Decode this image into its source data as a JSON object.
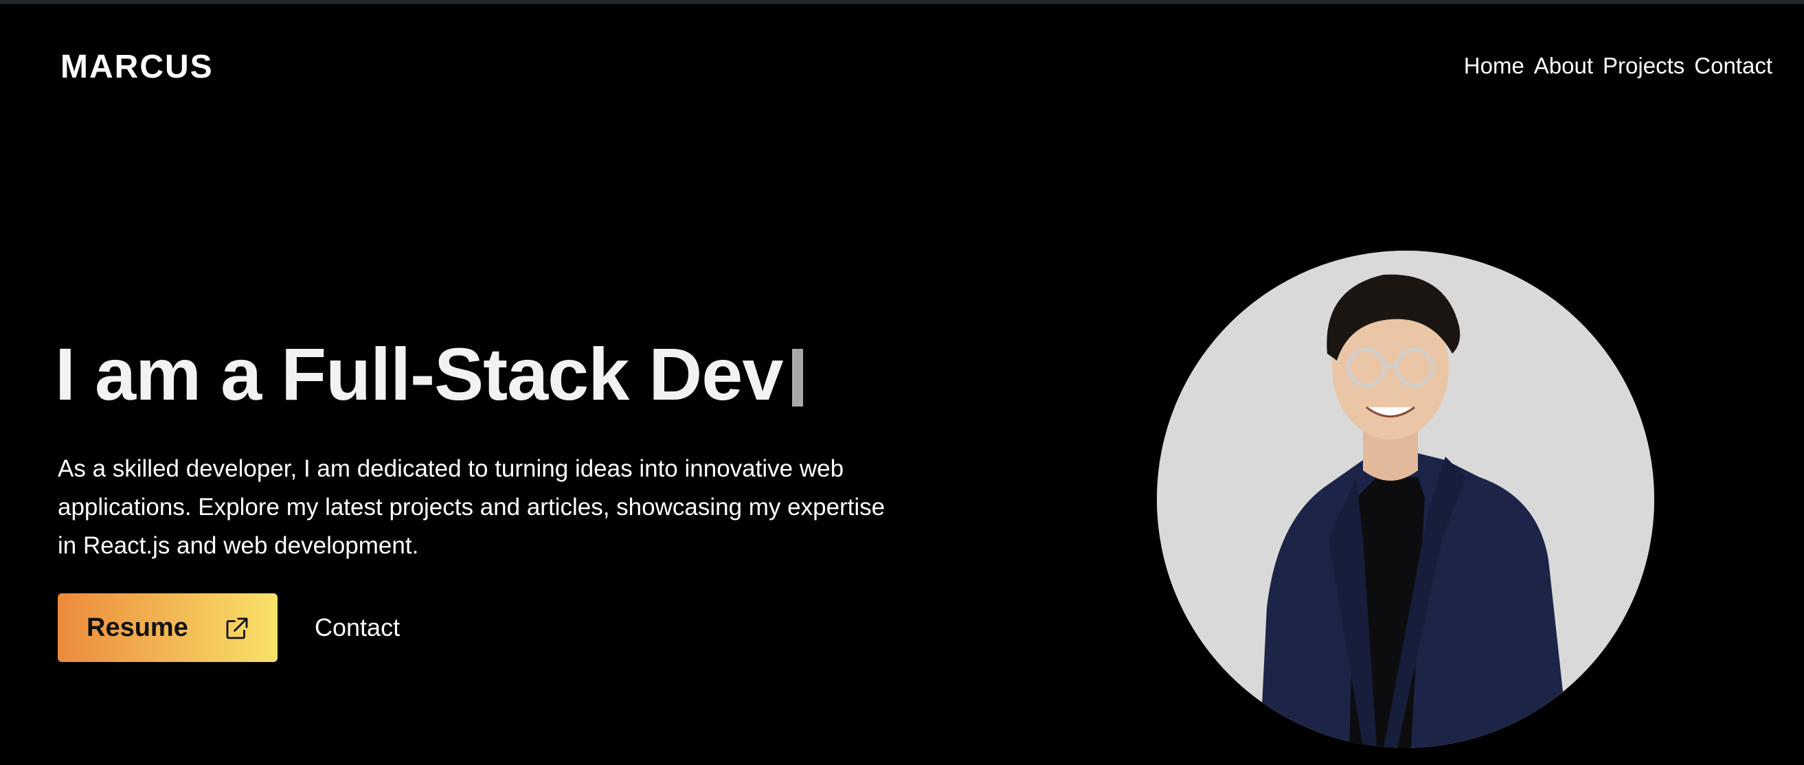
{
  "brand": {
    "name": "MARCUS"
  },
  "nav": {
    "items": [
      {
        "label": "Home"
      },
      {
        "label": "About"
      },
      {
        "label": "Projects"
      },
      {
        "label": "Contact"
      }
    ]
  },
  "hero": {
    "headline": "I am a Full-Stack Dev",
    "description": "As a skilled developer, I am dedicated to turning ideas into innovative web applications. Explore my latest projects and articles, showcasing my expertise in React.js and web development.",
    "resume_label": "Resume",
    "resume_icon": "external-link-icon",
    "contact_label": "Contact"
  },
  "portrait": {
    "icon": "profile-photo",
    "background_color": "#d9d9d9"
  },
  "colors": {
    "background": "#000000",
    "text": "#ffffff",
    "gradient_start": "#ec8a3c",
    "gradient_end": "#f8e26a",
    "caret": "#a8a8a8"
  }
}
